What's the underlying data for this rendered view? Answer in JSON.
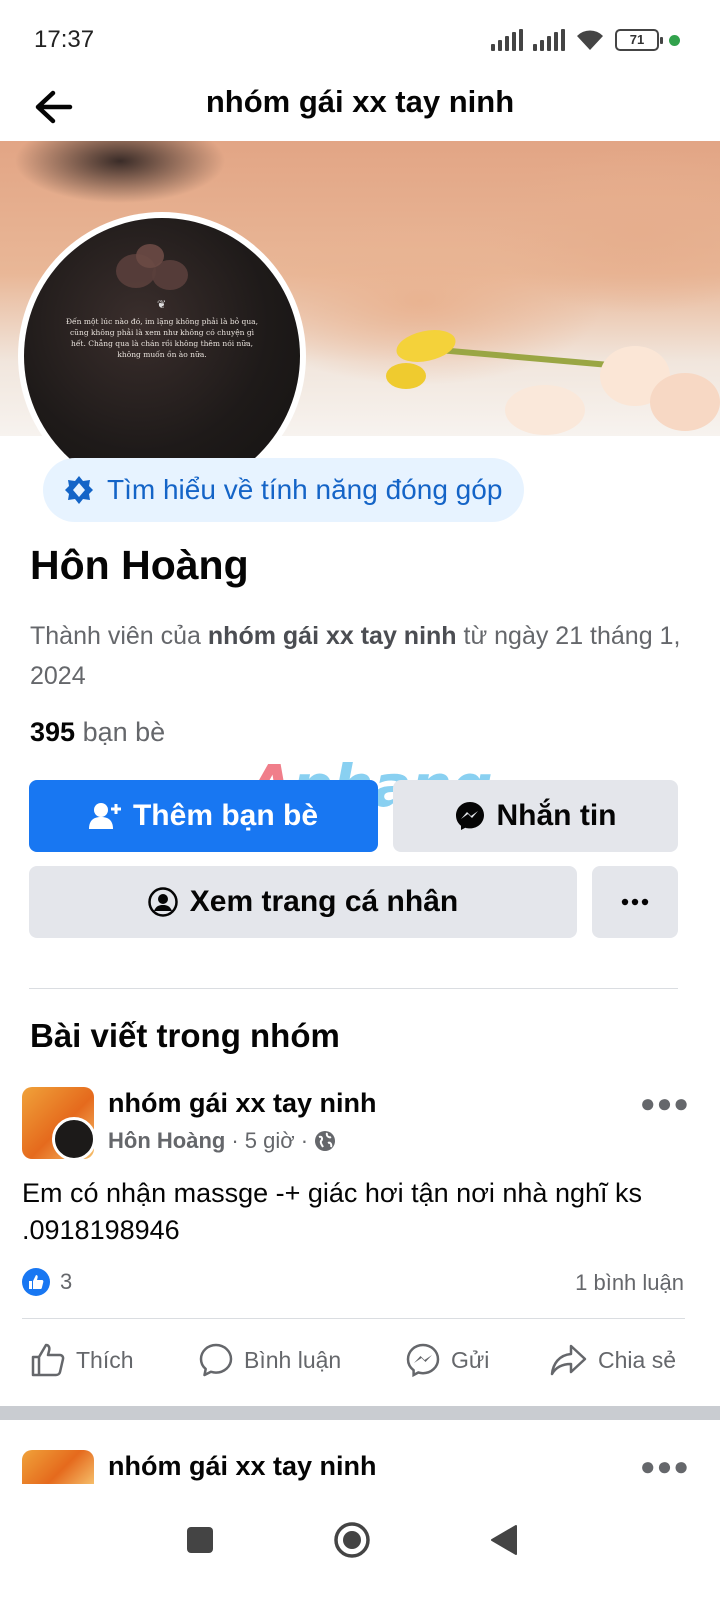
{
  "status_bar": {
    "time": "17:37",
    "battery": "71"
  },
  "header": {
    "title": "nhóm gái xx tay ninh"
  },
  "avatar_quote": "Đến một lúc nào đó, im lặng không phải là bỏ qua, cũng không phải là xem như không có chuyện gì hết. Chẳng qua là chán rồi không thêm nói nữa, không muốn ồn ào nữa.",
  "contribution": {
    "label": "Tìm hiểu về tính năng đóng góp"
  },
  "profile": {
    "name": "Hôn Hoàng",
    "member_prefix": "Thành viên của ",
    "member_group": "nhóm gái xx tay ninh",
    "member_suffix": " từ ngày 21 tháng 1, 2024",
    "friends_count": "395",
    "friends_label": " bạn bè"
  },
  "actions": {
    "add_friend": "Thêm bạn bè",
    "message": "Nhắn tin",
    "view_profile": "Xem trang cá nhân"
  },
  "watermark": {
    "prefix": "A",
    "rest": "phang"
  },
  "section_title": "Bài viết trong nhóm",
  "post": {
    "group": "nhóm gái xx tay ninh",
    "author": "Hôn Hoàng",
    "time": " · 5 giờ ·",
    "text": "Em có nhận  massge -+ giác  hơi tận nơi nhà nghĩ ks .0918198946",
    "likes": "3",
    "comments": "1 bình luận",
    "like_label": "Thích",
    "comment_label": "Bình luận",
    "send_label": "Gửi",
    "share_label": "Chia sẻ"
  },
  "post2": {
    "group": "nhóm gái xx tay ninh"
  },
  "colors": {
    "primary": "#1877f2",
    "secondary_bg": "#e4e6eb",
    "muted_text": "#65676b",
    "pill_bg": "#e7f3ff"
  }
}
